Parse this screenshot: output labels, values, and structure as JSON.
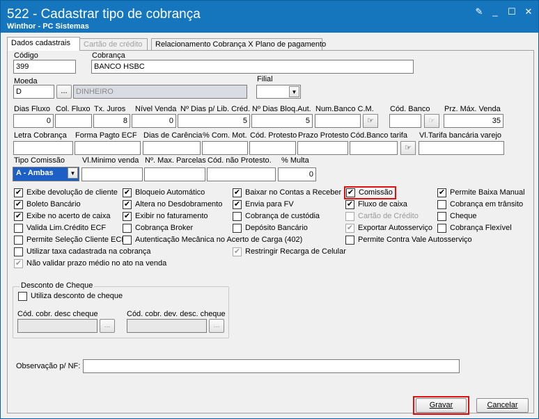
{
  "window": {
    "title": "522 - Cadastrar tipo de cobrança",
    "subtitle": "Winthor - PC Sistemas"
  },
  "tabs": [
    {
      "label": "Dados cadastrais"
    },
    {
      "label": "Cartão de crédito"
    },
    {
      "label": "Relacionamento Cobrança X Plano de pagamento"
    }
  ],
  "fields": {
    "codigo": {
      "label": "Código",
      "value": "399"
    },
    "cobranca": {
      "label": "Cobrança",
      "value": "BANCO HSBC"
    },
    "moeda": {
      "label": "Moeda",
      "value": "D",
      "desc": "DINHEIRO"
    },
    "filial": {
      "label": "Filial",
      "value": ""
    },
    "dias_fluxo": {
      "label": "Dias Fluxo",
      "value": "0"
    },
    "col_fluxo": {
      "label": "Col. Fluxo",
      "value": ""
    },
    "tx_juros": {
      "label": "Tx. Juros",
      "value": "8"
    },
    "nivel_venda": {
      "label": "Nível Venda",
      "value": "0"
    },
    "dias_lib_cred": {
      "label": "Nº Dias p/ Lib. Créd.",
      "value": "5"
    },
    "dias_bloq_aut": {
      "label": "Nº Dias Bloq.Aut.",
      "value": "5"
    },
    "num_banco_cm": {
      "label": "Num.Banco C.M.",
      "value": ""
    },
    "cod_banco": {
      "label": "Cód. Banco",
      "value": ""
    },
    "prz_max_venda": {
      "label": "Prz. Máx. Venda",
      "value": "35"
    },
    "letra_cobranca": {
      "label": "Letra Cobrança",
      "value": ""
    },
    "forma_pagto_ecf": {
      "label": "Forma Pagto ECF",
      "value": ""
    },
    "dias_carencia": {
      "label": "Dias de Carência",
      "value": ""
    },
    "com_mot": {
      "label": "% Com. Mot.",
      "value": ""
    },
    "cod_protesto": {
      "label": "Cód. Protesto",
      "value": ""
    },
    "prazo_protesto": {
      "label": "Prazo Protesto",
      "value": ""
    },
    "cod_banco_tarifa": {
      "label": "Cód.Banco tarifa",
      "value": ""
    },
    "vl_tarifa": {
      "label": "Vl.Tarifa bancária varejo",
      "value": ""
    },
    "tipo_comissao": {
      "label": "Tipo Comissão",
      "value": "A - Ambas"
    },
    "vl_minimo_venda": {
      "label": "Vl.Minimo venda",
      "value": ""
    },
    "max_parcelas": {
      "label": "Nº. Max. Parcelas",
      "value": ""
    },
    "cod_nao_protesto": {
      "label": "Cód. não  Protesto.",
      "value": ""
    },
    "multa": {
      "label": "% Multa",
      "value": "0"
    },
    "observacao": {
      "label": "Observação p/ NF:",
      "value": ""
    }
  },
  "checkboxes": [
    {
      "label": "Exibe devolução de cliente",
      "checked": true,
      "enabled": true
    },
    {
      "label": "Boleto Bancário",
      "checked": true,
      "enabled": true
    },
    {
      "label": "Exibe no acerto de caixa",
      "checked": true,
      "enabled": true
    },
    {
      "label": "Valida Lim.Crédito ECF",
      "checked": false,
      "enabled": true
    },
    {
      "label": "Permite Seleção Cliente ECF",
      "checked": false,
      "enabled": true
    },
    {
      "label": "Utilizar taxa cadastrada na cobrança",
      "checked": false,
      "enabled": true
    },
    {
      "label": "Não validar prazo médio no ato na venda",
      "checked": true,
      "enabled": false
    },
    {
      "label": "Bloqueio Automático",
      "checked": true,
      "enabled": true
    },
    {
      "label": "Altera no Desdobramento",
      "checked": true,
      "enabled": true
    },
    {
      "label": "Exibir no faturamento",
      "checked": true,
      "enabled": true
    },
    {
      "label": "Cobrança Broker",
      "checked": false,
      "enabled": true
    },
    {
      "label": "Autenticação Mecânica no Acerto de Carga (402)",
      "checked": false,
      "enabled": true
    },
    {
      "label": "Baixar no Contas a Receber",
      "checked": true,
      "enabled": true
    },
    {
      "label": "Envia para FV",
      "checked": true,
      "enabled": true
    },
    {
      "label": "Cobrança de custódia",
      "checked": false,
      "enabled": true
    },
    {
      "label": "Depósito Bancário",
      "checked": false,
      "enabled": true
    },
    {
      "label": "Restringir Recarga de Celular",
      "checked": true,
      "enabled": false
    },
    {
      "label": "Comissão",
      "checked": true,
      "enabled": true
    },
    {
      "label": "Fluxo de caixa",
      "checked": true,
      "enabled": true
    },
    {
      "label": "Cartão de Crédito",
      "checked": false,
      "enabled": false
    },
    {
      "label": "Exportar Autosserviço",
      "checked": true,
      "enabled": false
    },
    {
      "label": "Permite Contra Vale Autosserviço",
      "checked": false,
      "enabled": true
    },
    {
      "label": "Permite Baixa Manual",
      "checked": true,
      "enabled": true
    },
    {
      "label": "Cobrança em trânsito",
      "checked": false,
      "enabled": true
    },
    {
      "label": "Cheque",
      "checked": false,
      "enabled": true
    },
    {
      "label": "Cobrança Flexível",
      "checked": false,
      "enabled": true
    }
  ],
  "desconto_cheque": {
    "title": "Desconto de Cheque",
    "utiliza": "Utiliza desconto de cheque",
    "cod_desc_label": "Cód. cobr. desc cheque",
    "cod_dev_label": "Cód. cobr. dev. desc. cheque"
  },
  "buttons": {
    "ellipsis": "...",
    "gravar": "Gravar",
    "cancelar": "Cancelar"
  }
}
